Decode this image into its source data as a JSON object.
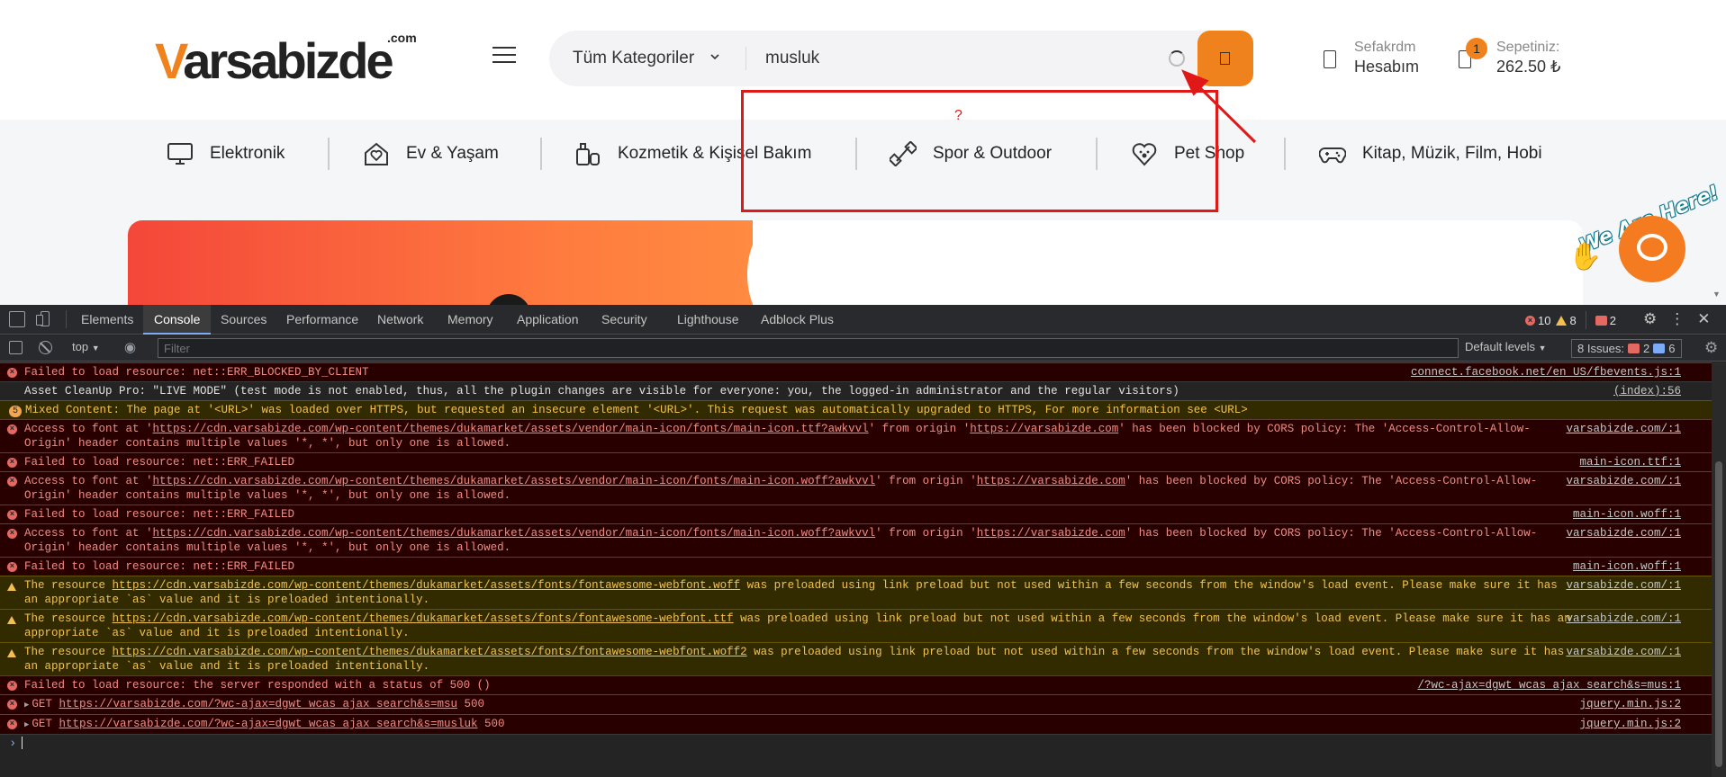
{
  "site": {
    "logo": {
      "main": "Varsabizde",
      "com": ".com"
    },
    "search": {
      "category": "Tüm Kategoriler",
      "query": "musluk"
    },
    "account": {
      "line1": "Sefakrdm",
      "line2": "Hesabım"
    },
    "cart": {
      "count": "1",
      "label": "Sepetiniz:",
      "total": "262.50 ₺"
    },
    "categories": [
      {
        "label": "Elektronik",
        "icon": "monitor-icon"
      },
      {
        "label": "Ev & Yaşam",
        "icon": "home-heart-icon"
      },
      {
        "label": "Kozmetik & Kişisel Bakım",
        "icon": "cosmetics-icon"
      },
      {
        "label": "Spor & Outdoor",
        "icon": "dumbbell-icon"
      },
      {
        "label": "Pet Shop",
        "icon": "paw-heart-icon"
      },
      {
        "label": "Kitap, Müzik, Film, Hobi",
        "icon": "gamepad-icon"
      }
    ],
    "chat": {
      "text": "We Are Here!"
    },
    "annotation": {
      "question_mark": "?"
    }
  },
  "devtools": {
    "tabs": [
      "Elements",
      "Console",
      "Sources",
      "Performance",
      "Network",
      "Memory",
      "Application",
      "Security",
      "Lighthouse",
      "Adblock Plus"
    ],
    "active_tab": "Console",
    "counts": {
      "errors": "10",
      "warnings": "8",
      "issues": "2"
    },
    "toolbar": {
      "context": "top",
      "filter_placeholder": "Filter",
      "levels": "Default levels",
      "issues_label": "8 Issues:",
      "issues_errors": "2",
      "issues_info": "6"
    },
    "console": [
      {
        "level": "error",
        "text": "Failed to load resource: net::ERR_BLOCKED_BY_CLIENT",
        "source": "connect.facebook.net/en_US/fbevents.js:1"
      },
      {
        "level": "log",
        "text": "Asset CleanUp Pro: \"LIVE MODE\" (test mode is not enabled, thus, all the plugin changes are visible for everyone: you, the logged-in administrator and the regular visitors)",
        "source": "(index):56"
      },
      {
        "level": "warning-group",
        "badge": "5",
        "text": "Mixed Content: The page at '<URL>' was loaded over HTTPS, but requested an insecure element '<URL>'. This request was automatically upgraded to HTTPS, For more information see <URL>",
        "source": ""
      },
      {
        "level": "error",
        "text_before": "Access to font at '",
        "url": "https://cdn.varsabizde.com/wp-content/themes/dukamarket/assets/vendor/main-icon/fonts/main-icon.ttf?awkvvl",
        "text_mid": "' from origin '",
        "url2": "https://varsabizde.com",
        "text_after": "' has been blocked by CORS policy: The 'Access-Control-Allow-Origin' header contains multiple values '*, *', but only one is allowed.",
        "source": "varsabizde.com/:1"
      },
      {
        "level": "error",
        "text": "Failed to load resource: net::ERR_FAILED",
        "source": "main-icon.ttf:1"
      },
      {
        "level": "error",
        "text_before": "Access to font at '",
        "url": "https://cdn.varsabizde.com/wp-content/themes/dukamarket/assets/vendor/main-icon/fonts/main-icon.woff?awkvvl",
        "text_mid": "' from origin '",
        "url2": "https://varsabizde.com",
        "text_after": "' has been blocked by CORS policy: The 'Access-Control-Allow-Origin' header contains multiple values '*, *', but only one is allowed.",
        "source": "varsabizde.com/:1"
      },
      {
        "level": "error",
        "text": "Failed to load resource: net::ERR_FAILED",
        "source": "main-icon.woff:1"
      },
      {
        "level": "error",
        "text_before": "Access to font at '",
        "url": "https://cdn.varsabizde.com/wp-content/themes/dukamarket/assets/vendor/main-icon/fonts/main-icon.woff?awkvvl",
        "text_mid": "' from origin '",
        "url2": "https://varsabizde.com",
        "text_after": "' has been blocked by CORS policy: The 'Access-Control-Allow-Origin' header contains multiple values '*, *', but only one is allowed.",
        "source": "varsabizde.com/:1"
      },
      {
        "level": "error",
        "text": "Failed to load resource: net::ERR_FAILED",
        "source": "main-icon.woff:1"
      },
      {
        "level": "warning",
        "text_before": "The resource ",
        "url": "https://cdn.varsabizde.com/wp-content/themes/dukamarket/assets/fonts/fontawesome-webfont.woff",
        "text_after": " was preloaded using link preload but not used within a few seconds from the window's load event. Please make sure it has an appropriate `as` value and it is preloaded intentionally.",
        "source": "varsabizde.com/:1"
      },
      {
        "level": "warning",
        "text_before": "The resource ",
        "url": "https://cdn.varsabizde.com/wp-content/themes/dukamarket/assets/fonts/fontawesome-webfont.ttf",
        "text_after": " was preloaded using link preload but not used within a few seconds from the window's load event. Please make sure it has an appropriate `as` value and it is preloaded intentionally.",
        "source": "varsabizde.com/:1"
      },
      {
        "level": "warning",
        "text_before": "The resource ",
        "url": "https://cdn.varsabizde.com/wp-content/themes/dukamarket/assets/fonts/fontawesome-webfont.woff2",
        "text_after": " was preloaded using link preload but not used within a few seconds from the window's load event. Please make sure it has an appropriate `as` value and it is preloaded intentionally.",
        "source": "varsabizde.com/:1"
      },
      {
        "level": "error",
        "text": "Failed to load resource: the server responded with a status of 500 ()",
        "source": "/?wc-ajax=dgwt_wcas_ajax_search&s=mus:1"
      },
      {
        "level": "error-get",
        "text_before": "GET ",
        "url": "https://varsabizde.com/?wc-ajax=dgwt_wcas_ajax_search&s=msu",
        "text_after": " 500",
        "source": "jquery.min.js:2"
      },
      {
        "level": "error-get",
        "text_before": "GET ",
        "url": "https://varsabizde.com/?wc-ajax=dgwt_wcas_ajax_search&s=musluk",
        "text_after": " 500",
        "source": "jquery.min.js:2"
      }
    ],
    "prompt": "›"
  },
  "colors": {
    "brand_orange": "#f0821e",
    "annotation_red": "#e01818",
    "error_text": "#f28b82",
    "warning_text": "#f2c14e"
  }
}
